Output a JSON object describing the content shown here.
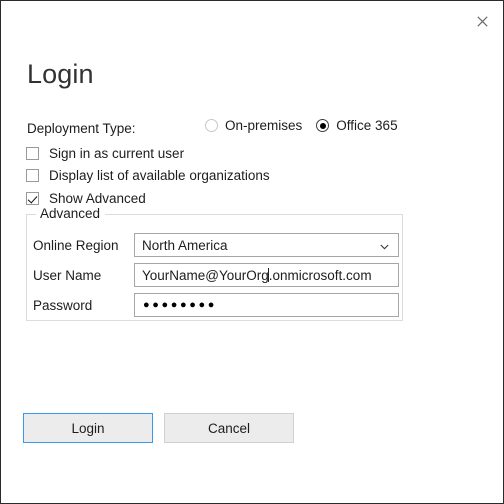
{
  "dialog": {
    "title": "Login",
    "close_icon": "close-icon"
  },
  "deployment": {
    "label": "Deployment Type:",
    "options": [
      {
        "label": "On-premises",
        "selected": false
      },
      {
        "label": "Office 365",
        "selected": true
      }
    ]
  },
  "checkboxes": [
    {
      "label": "Sign in as current user",
      "checked": false
    },
    {
      "label": "Display list of available organizations",
      "checked": false
    },
    {
      "label": "Show Advanced",
      "checked": true
    }
  ],
  "advanced": {
    "legend": "Advanced",
    "online_region": {
      "label": "Online Region",
      "value": "North America",
      "chevron_icon": "chevron-down-icon"
    },
    "user_name": {
      "label": "User Name",
      "value_before_caret": "YourName@YourOrg",
      "value_after_caret": ".onmicrosoft.com",
      "value": "YourName@YourOrg.onmicrosoft.com"
    },
    "password": {
      "label": "Password",
      "masked_value": "●●●●●●●●",
      "character_count": 8
    }
  },
  "buttons": {
    "login": "Login",
    "cancel": "Cancel"
  },
  "colors": {
    "accent_focus": "#3b9bea",
    "button_face": "#ececec",
    "border": "#2b2b2b",
    "text": "#1d1d1d"
  }
}
